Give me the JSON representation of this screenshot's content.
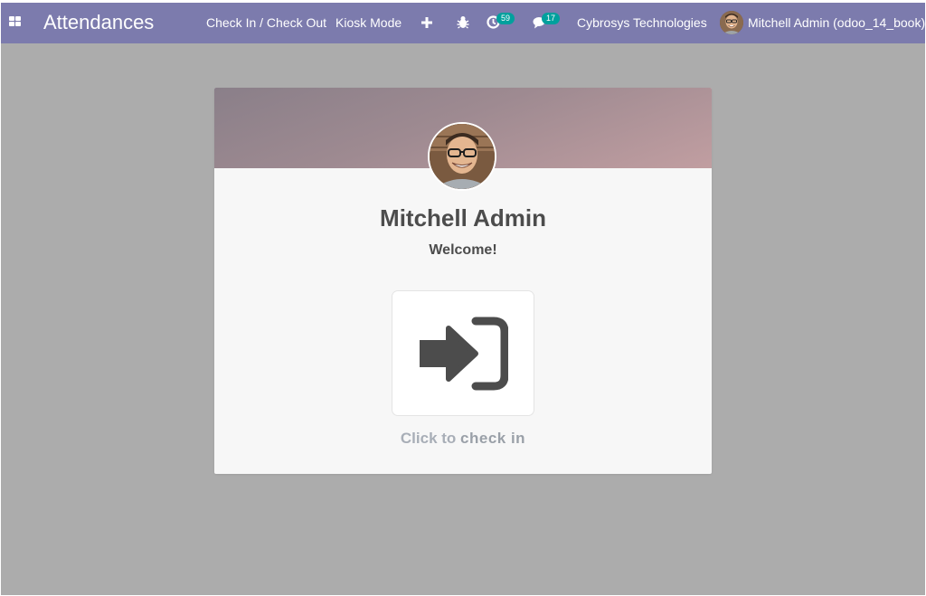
{
  "navbar": {
    "app_title": "Attendances",
    "menu": {
      "check_in_out": "Check In / Check Out",
      "kiosk_mode": "Kiosk Mode"
    },
    "icons": [
      "apps-grid-icon",
      "plus-icon",
      "bug-icon",
      "activity-clock-icon",
      "chat-icon"
    ],
    "activity_count": "59",
    "messages_count": "17",
    "company": "Cybrosys Technologies",
    "user_label": "Mitchell Admin (odoo_14_book)"
  },
  "card": {
    "employee_name": "Mitchell Admin",
    "greeting": "Welcome!",
    "button_icon": "sign-in-icon",
    "caption_prefix": "Click to ",
    "caption_action": "check in"
  },
  "colors": {
    "navbar": "#7c7bad",
    "background": "#acacac",
    "card": "#f7f7f7",
    "badge": "#00a09d",
    "text": "#4c4c4c",
    "caption": "#a8aeb7"
  }
}
